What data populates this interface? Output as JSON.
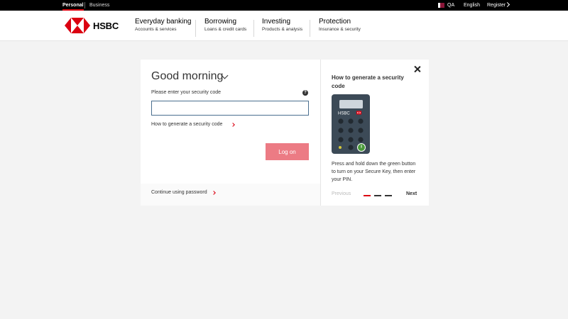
{
  "topbar": {
    "personal": "Personal",
    "business": "Business",
    "country": "QA",
    "language": "English",
    "register": "Register"
  },
  "brand": {
    "name": "HSBC",
    "red": "#db0011"
  },
  "nav": [
    {
      "title": "Everyday banking",
      "subtitle": "Accounts & services"
    },
    {
      "title": "Borrowing",
      "subtitle": "Loans & credit cards"
    },
    {
      "title": "Investing",
      "subtitle": "Products & analysis"
    },
    {
      "title": "Protection",
      "subtitle": "Insurance & security"
    }
  ],
  "login": {
    "greeting": "Good morning",
    "security_label": "Please enter your security code",
    "help_glyph": "?",
    "code_value": "",
    "howto_link": "How to generate a security code",
    "logon_button": "Log on",
    "continue_password": "Continue using password"
  },
  "helper_panel": {
    "title": "How to generate a security code",
    "device_brand": "HSBC",
    "description": "Press and hold down the green button to turn on your Secure Key, then enter your PIN.",
    "previous": "Previous",
    "next": "Next",
    "step_count": 3,
    "current_step": 1
  }
}
